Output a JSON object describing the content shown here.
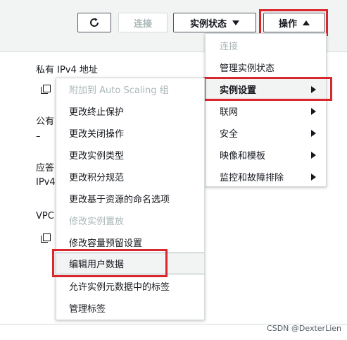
{
  "toolbar": {
    "connect_label": "连接",
    "instance_state_label": "实例状态",
    "actions_label": "操作"
  },
  "background": {
    "private_ipv4_label": "私有 IPv4 地址",
    "public_partial": "公有",
    "dash": "–",
    "answer_partial": "应答",
    "ipv4_partial": "IPv4",
    "vpc_partial": "VPC"
  },
  "actions_menu": {
    "items": [
      {
        "label": "连接"
      },
      {
        "label": "管理实例状态"
      },
      {
        "label": "实例设置"
      },
      {
        "label": "联网"
      },
      {
        "label": "安全"
      },
      {
        "label": "映像和模板"
      },
      {
        "label": "监控和故障排除"
      }
    ]
  },
  "instance_settings_submenu": {
    "items": [
      {
        "label": "附加到 Auto Scaling 组"
      },
      {
        "label": "更改终止保护"
      },
      {
        "label": "更改关闭操作"
      },
      {
        "label": "更改实例类型"
      },
      {
        "label": "更改积分规范"
      },
      {
        "label": "更改基于资源的命名选项"
      },
      {
        "label": "修改实例置放"
      },
      {
        "label": "修改容量预留设置"
      },
      {
        "label": "编辑用户数据"
      },
      {
        "label": "允许实例元数据中的标签"
      },
      {
        "label": "管理标签"
      }
    ]
  },
  "watermark": "CSDN @DexterLien",
  "colors": {
    "highlight_red": "#d9272e",
    "disabled_text": "#aab7b8",
    "border": "#d5dbdb"
  }
}
